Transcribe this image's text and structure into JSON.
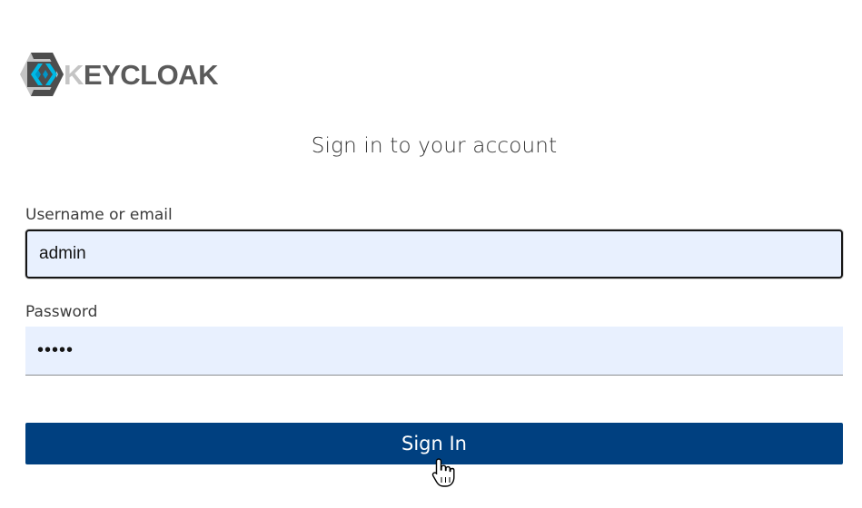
{
  "brand": {
    "logo_k": "K",
    "logo_rest": "EYCLOAK",
    "accent": "#00b9e4",
    "dark": "#4d4d4d",
    "light": "#c4c4c4"
  },
  "form": {
    "title": "Sign in to your account",
    "username_label": "Username or email",
    "username_value": "admin",
    "password_label": "Password",
    "password_value": "•••••",
    "submit_label": "Sign In",
    "submit_color": "#004080"
  },
  "cursor": {
    "icon": "hand-pointer-icon"
  }
}
